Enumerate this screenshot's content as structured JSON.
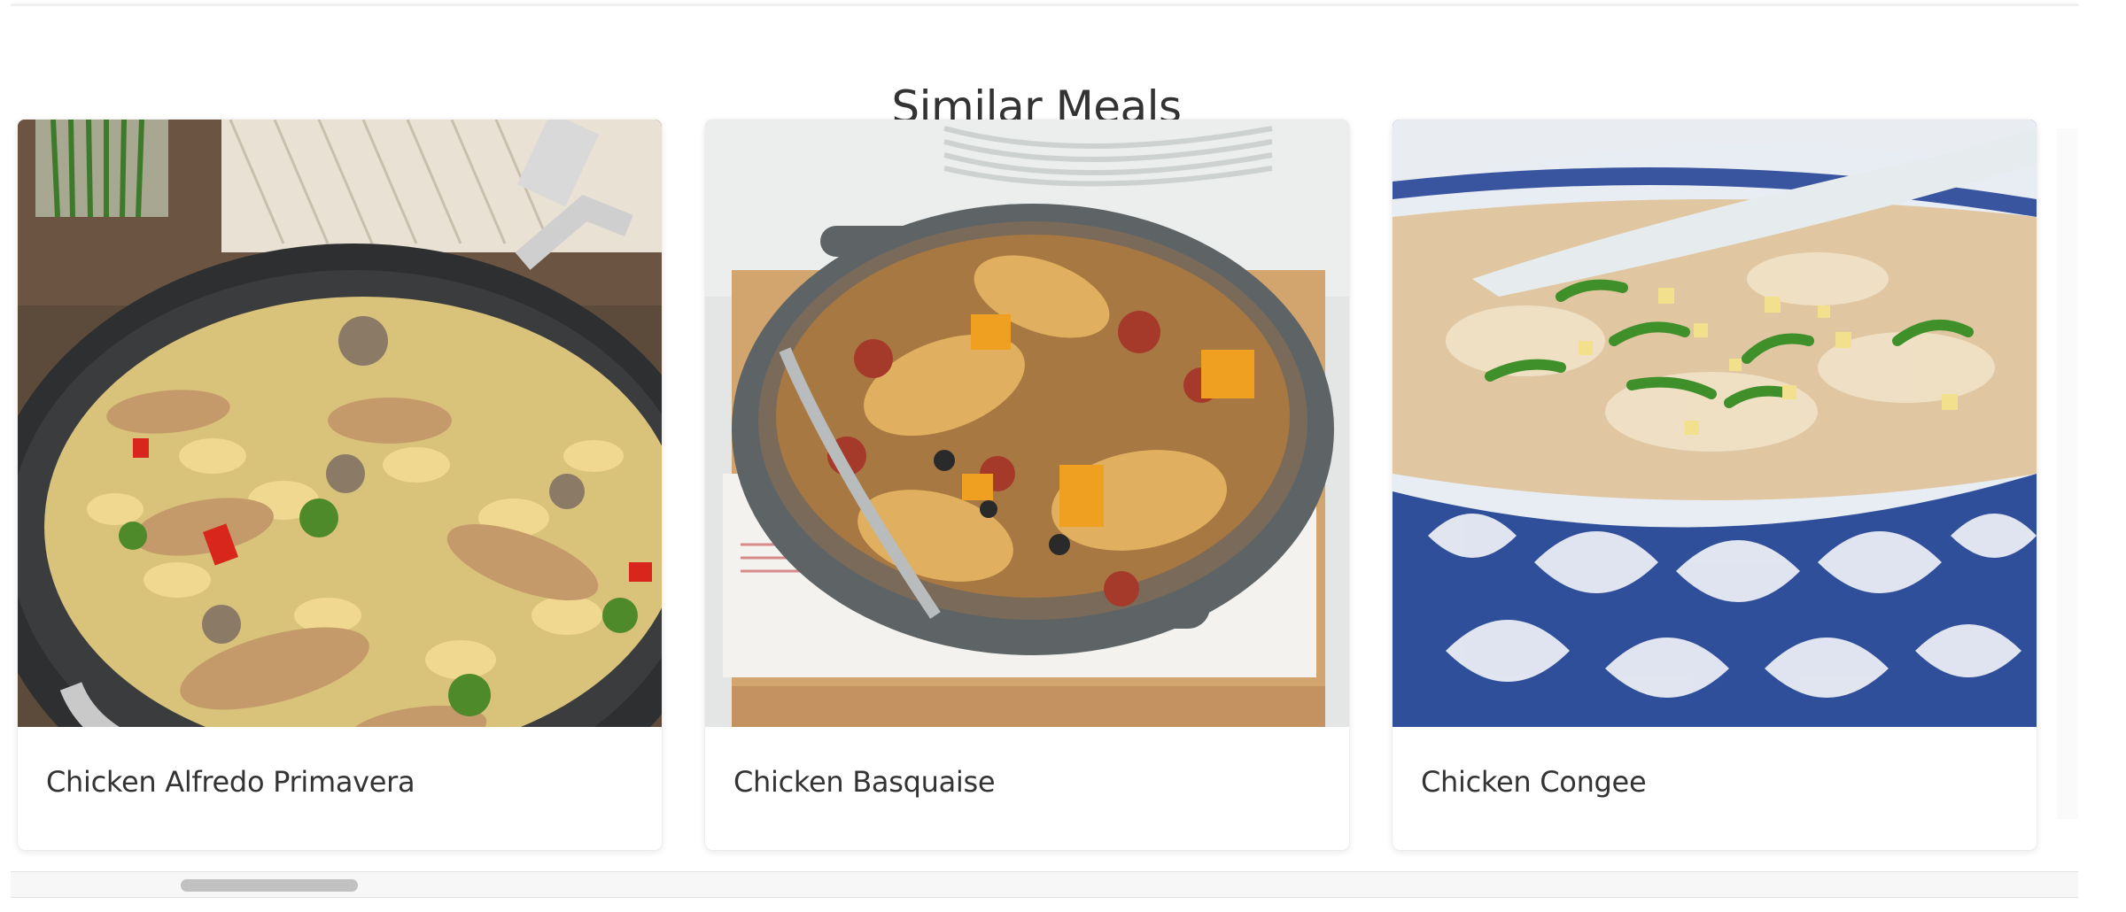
{
  "section": {
    "title": "Similar Meals"
  },
  "cards": [
    {
      "name": "Chicken Alfredo Primavera",
      "image_alt": "Bow-tie pasta with sliced chicken, mushrooms and broccoli in a dark skillet"
    },
    {
      "name": "Chicken Basquaise",
      "image_alt": "Chicken pieces with rice, peppers and chorizo in a grey braiser"
    },
    {
      "name": "Chicken Congee",
      "image_alt": "Rice porridge with scallions and garlic in a blue and white bowl"
    }
  ],
  "scrollbar": {
    "position_fraction": 0.09
  },
  "colors": {
    "text": "#333333",
    "card_bg": "#ffffff",
    "scroll_thumb": "#c1c1c1"
  }
}
